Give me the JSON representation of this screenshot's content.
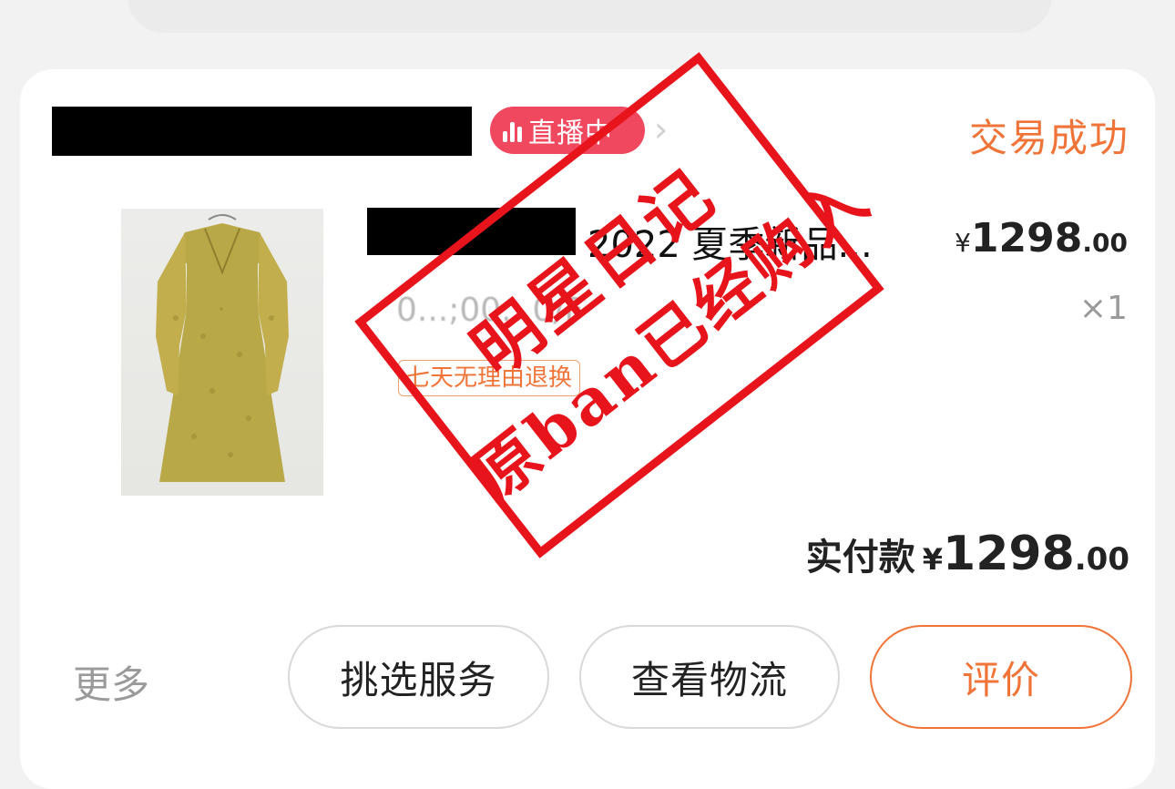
{
  "store": {
    "live_badge": "直播中",
    "status": "交易成功"
  },
  "product": {
    "title": "2022 夏季新品...",
    "price": {
      "currency": "¥",
      "integer": "1298",
      "decimal": ".00"
    },
    "sku": "0...;00...0/F",
    "quantity": "×1",
    "return_tag": "七天无理由退换"
  },
  "total": {
    "label": "实付款",
    "currency": "¥",
    "integer": "1298",
    "decimal": ".00"
  },
  "actions": {
    "more": "更多",
    "service": "挑选服务",
    "logistics": "查看物流",
    "review": "评价"
  },
  "stamp": {
    "line1": "明星日记",
    "line2": "原ban已经购入"
  },
  "colors": {
    "accent": "#f07438",
    "live_badge": "#f0485f",
    "stamp": "#e8141b"
  }
}
